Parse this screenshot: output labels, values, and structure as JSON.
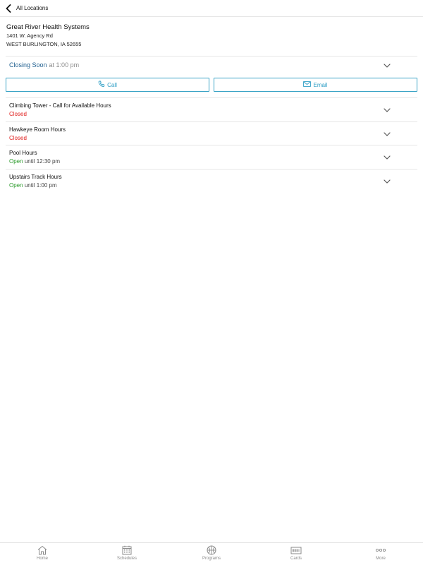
{
  "nav": {
    "back_label": "All Locations"
  },
  "location": {
    "name": "Great River Health Systems",
    "address_line1": "1401 W. Agency Rd",
    "address_line2": "WEST BURLINGTON, IA 52655"
  },
  "status": {
    "state": "Closing Soon",
    "detail": "at 1:00 pm",
    "state_color": "#1f5f8f"
  },
  "actions": {
    "call_label": "Call",
    "email_label": "Email",
    "accent_color": "#3aa3c6"
  },
  "facilities": [
    {
      "name": "Climbing Tower - Call for Available Hours",
      "status": "Closed",
      "until": ""
    },
    {
      "name": "Hawkeye Room Hours",
      "status": "Closed",
      "until": ""
    },
    {
      "name": "Pool Hours",
      "status": "Open",
      "until": "until 12:30 pm"
    },
    {
      "name": "Upstairs Track Hours",
      "status": "Open",
      "until": "until 1:00 pm"
    }
  ],
  "status_colors": {
    "closed": "#e0201e",
    "open": "#2a9a2a"
  },
  "tabs": [
    {
      "label": "Home",
      "icon": "home-icon"
    },
    {
      "label": "Schedules",
      "icon": "calendar-icon"
    },
    {
      "label": "Programs",
      "icon": "basketball-icon"
    },
    {
      "label": "Cards",
      "icon": "card-icon"
    },
    {
      "label": "More",
      "icon": "more-icon"
    }
  ]
}
